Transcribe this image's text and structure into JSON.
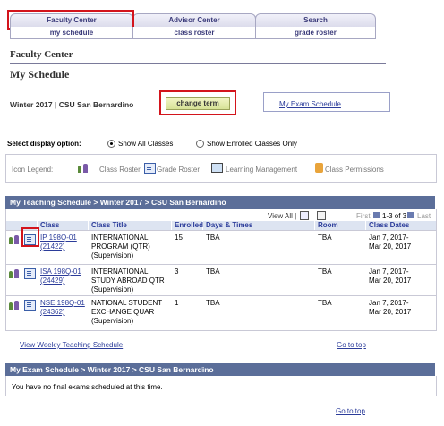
{
  "tabs": [
    {
      "label": "Faculty Center"
    },
    {
      "label": "Advisor Center"
    },
    {
      "label": "Search"
    }
  ],
  "subtabs": [
    {
      "label": "my schedule"
    },
    {
      "label": "class roster"
    },
    {
      "label": "grade roster"
    }
  ],
  "page": {
    "section_title": "Faculty Center",
    "title": "My Schedule"
  },
  "term": {
    "label": "Winter 2017 | CSU San Bernardino",
    "change_button": "change term",
    "exam_link": "My Exam Schedule"
  },
  "display_option": {
    "label": "Select display option:",
    "options": [
      {
        "label": "Show All Classes",
        "selected": true
      },
      {
        "label": "Show Enrolled Classes Only",
        "selected": false
      }
    ]
  },
  "legend": {
    "label": "Icon Legend:",
    "items": [
      {
        "label": "Class Roster",
        "icon": "class-roster-icon"
      },
      {
        "label": "Grade Roster",
        "icon": "grade-roster-icon"
      },
      {
        "label": "Learning Management",
        "icon": "learning-management-icon"
      },
      {
        "label": "Class Permissions",
        "icon": "class-permissions-icon"
      }
    ]
  },
  "schedule": {
    "header": "My Teaching Schedule > Winter 2017 > CSU San Bernardino",
    "view_all": "View All |",
    "first": "First",
    "range": "1-3 of 3",
    "last": "Last",
    "columns": [
      "Class",
      "Class Title",
      "Enrolled",
      "Days & Times",
      "Room",
      "Class Dates"
    ],
    "rows": [
      {
        "class_code": "IP 198Q-01",
        "class_nbr": "(21422)",
        "title": [
          "INTERNATIONAL",
          "PROGRAM (QTR)",
          "(Supervision)"
        ],
        "enrolled": "15",
        "days": "TBA",
        "room": "TBA",
        "dates": [
          "Jan 7, 2017-",
          "Mar 20, 2017"
        ]
      },
      {
        "class_code": "ISA 198Q-01",
        "class_nbr": "(24429)",
        "title": [
          "INTERNATIONAL",
          "STUDY ABROAD QTR",
          "(Supervision)"
        ],
        "enrolled": "3",
        "days": "TBA",
        "room": "TBA",
        "dates": [
          "Jan 7, 2017-",
          "Mar 20, 2017"
        ]
      },
      {
        "class_code": "NSE 198Q-01",
        "class_nbr": "(24362)",
        "title": [
          "NATIONAL STUDENT",
          "EXCHANGE QUAR",
          "(Supervision)"
        ],
        "enrolled": "1",
        "days": "TBA",
        "room": "TBA",
        "dates": [
          "Jan 7, 2017-",
          "Mar 20, 2017"
        ]
      }
    ],
    "weekly_link": "View Weekly Teaching Schedule",
    "go_top": "Go to top"
  },
  "exam": {
    "header": "My Exam Schedule > Winter 2017 > CSU San Bernardino",
    "message": "You have no final exams scheduled at this time.",
    "go_top": "Go to top"
  },
  "colors": {
    "highlight": "#d3141c",
    "panel_header": "#5b6e99",
    "link": "#2b3c9a"
  }
}
